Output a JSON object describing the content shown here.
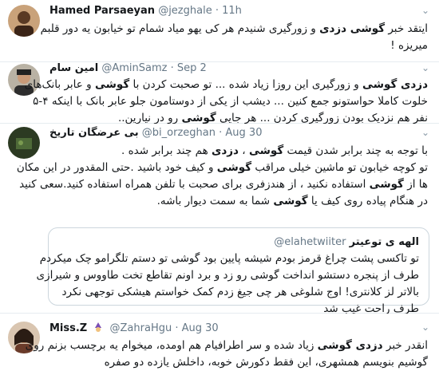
{
  "tweets": [
    {
      "name": "Hamed Parsaeyan",
      "handle": "@jezghale",
      "sep": "·",
      "time": "11h",
      "lines": [
        [
          "ایتقد خبر ",
          "گوشی دزدی",
          " و زورگیری شنیدم هر کی یهو میاد شمام تو خیابون یه دور قلبم"
        ],
        [
          "میریزه !"
        ]
      ]
    },
    {
      "name": "امین سام",
      "handle": "@AminSamz",
      "sep": "·",
      "time": "Sep 2",
      "lines": [
        [
          "",
          "دزدی گوشی",
          " و زورگیری این روزا زیاد شده ... تو صحبت کردن با ",
          "گوشی",
          " و عابر بانک‌های"
        ],
        [
          "خلوت کاملا حواستونو جمع کنین ... دیشب از یکی از دوستامون جلو عابر بانک با اینکه ۴-۵"
        ],
        [
          "نفر هم نزدیک بودن زورگیری کردن ... هر جایی ",
          "گوشی",
          " رو در نیارین.."
        ]
      ]
    },
    {
      "name": "بی عرضگان تاریخ",
      "handle": "@bi_orzeghan",
      "sep": "·",
      "time": "Aug 30",
      "lines": [
        [
          "با توجه به چند برابر شدن قیمت ",
          "گوشی",
          " ، ",
          "دزدی",
          " هم چند برابر شده ."
        ],
        [
          "تو کوچه خیابون تو ماشین خیلی مراقب ",
          "گوشی",
          " و کیف خود باشید .حتی المقدور در این مکان"
        ],
        [
          "ها از ",
          "گوشی",
          " استفاده نکنید ، از هندزفری برای صحبت با تلفن همراه استفاده کنید.سعی کنید"
        ],
        [
          "در هنگام پیاده روی کیف یا ",
          "گوشی",
          " شما به سمت دیوار باشه."
        ]
      ],
      "quote": {
        "name": "الهه ی توعیتر",
        "handle": "@elahetwiiter",
        "lines": [
          [
            "تو تاکسی پشت چراغ قرمز بودم شیشه پایین بود گوشی تو دستم تلگرامو چک میکردم"
          ],
          [
            "طرف از پنجره دستشو انداخت گوشی رو زد و برد اونم تقاطع تخت طاووس و شیرازی"
          ],
          [
            "بالاتر لز کلانتری! اوج شلوغی هر چی جیغ زدم کمک خواستم هیشکی توجهی نکرد"
          ],
          [
            "طرف راحت غیب شد"
          ]
        ]
      }
    },
    {
      "name": "Miss.Z",
      "handle": "@ZahraHgu",
      "sep": "·",
      "time": "Aug 30",
      "lines": [
        [
          "انقدر خبر ",
          "دزدی گوشی",
          " زیاد شده و سر اطرافیام هم اومده، میخوام یه برچسب بزنم روی"
        ],
        [
          "گوشیم بنویسم همشهری، این فقط دکورش خوبه، داخلش یازده دو صفره"
        ]
      ]
    }
  ],
  "colors": {
    "text": "#14171a",
    "secondary": "#657786",
    "border": "#e6ecf0"
  }
}
